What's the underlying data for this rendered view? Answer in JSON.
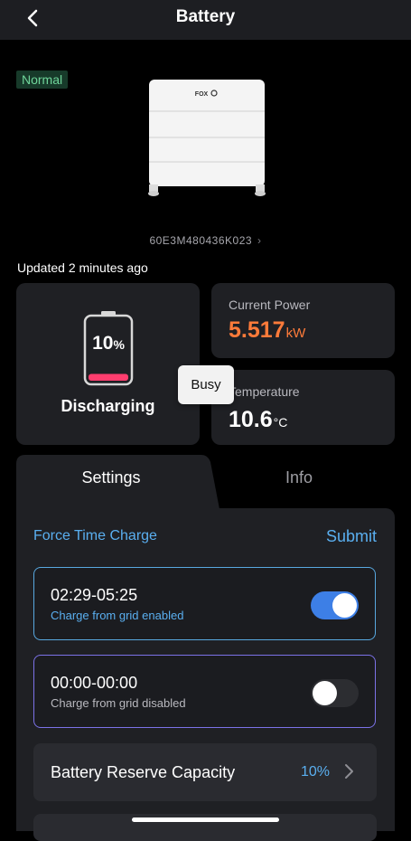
{
  "header": {
    "title": "Battery",
    "back_icon": "chevron-left-icon"
  },
  "device": {
    "status": "Normal",
    "brand": "FOX",
    "serial": "60E3M480436K023"
  },
  "updated_text": "Updated 2 minutes ago",
  "battery": {
    "soc_value": "10",
    "soc_unit": "%",
    "soc_fraction": 0.1,
    "state": "Discharging",
    "fill_color": "#ff3d6e"
  },
  "power": {
    "label": "Current Power",
    "value": "5.517",
    "unit": "kW",
    "color": "#ff7b3a"
  },
  "temperature": {
    "label": "Temperature",
    "value": "10.6",
    "unit": "°C"
  },
  "tooltip": "Busy",
  "tabs": [
    {
      "label": "Settings",
      "active": true
    },
    {
      "label": "Info",
      "active": false
    }
  ],
  "force_charge": {
    "title": "Force Time Charge",
    "submit_label": "Submit",
    "slots": [
      {
        "time": "02:29-05:25",
        "note": "Charge from grid enabled",
        "enabled": true
      },
      {
        "time": "00:00-00:00",
        "note": "Charge from grid disabled",
        "enabled": false
      }
    ]
  },
  "reserve": {
    "label": "Battery Reserve Capacity",
    "value": "10%"
  },
  "colors": {
    "accent": "#5aaff0",
    "toggle_on": "#3d7fe6",
    "panel": "#1f2024"
  }
}
